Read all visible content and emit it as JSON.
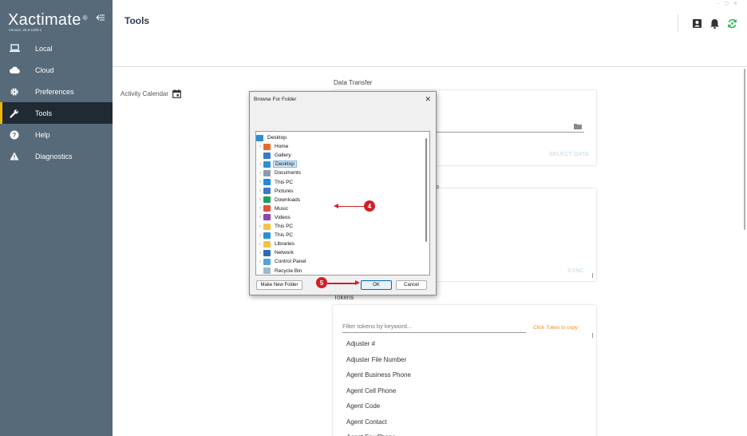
{
  "sidebar": {
    "brand": "Xactimate",
    "brand_mark": "®",
    "version": "Version: 25.8.1000.1",
    "items": [
      {
        "label": "Local",
        "icon": "laptop-icon"
      },
      {
        "label": "Cloud",
        "icon": "cloud-icon"
      },
      {
        "label": "Preferences",
        "icon": "gear-icon"
      },
      {
        "label": "Tools",
        "icon": "wrench-icon"
      },
      {
        "label": "Help",
        "icon": "help-icon"
      },
      {
        "label": "Diagnostics",
        "icon": "warning-icon"
      }
    ],
    "active": "Tools",
    "accent": "#f2b705"
  },
  "header": {
    "title": "Tools"
  },
  "content": {
    "activity_calendar": "Activity Calendar",
    "data_transfer_label": "Data Transfer",
    "select_data": "SELECT DATA",
    "sync": "SYNC",
    "partial_label": "p",
    "tokens_label": "Tokens",
    "filter_placeholder": "Filter tokens by keyword...",
    "token_hint": "Click Token to copy",
    "tokens": [
      "Adjuster #",
      "Adjuster File Number",
      "Agent Business Phone",
      "Agent Cell Phone",
      "Agent Code",
      "Agent Contact",
      "Agent Fax Phone"
    ]
  },
  "dialog": {
    "title": "Browse For Folder",
    "close": "✕",
    "tree": [
      {
        "label": "Desktop",
        "icon": "desktop-folder-icon",
        "color": "#2b8fd6",
        "indent": 0,
        "chev": false
      },
      {
        "label": "Home",
        "icon": "home-icon",
        "color": "#e86a2c",
        "indent": 1,
        "chev": true
      },
      {
        "label": "Gallery",
        "icon": "gallery-icon",
        "color": "#3a78c9",
        "indent": 1,
        "chev": false
      },
      {
        "label": "Desktop",
        "icon": "desktop-folder-icon",
        "color": "#2b8fd6",
        "indent": 1,
        "chev": true,
        "selected": true
      },
      {
        "label": "Documents",
        "icon": "documents-icon",
        "color": "#8a9bb0",
        "indent": 1,
        "chev": true
      },
      {
        "label": "This PC",
        "icon": "cloud-icon",
        "color": "#1e88e5",
        "indent": 1,
        "chev": true
      },
      {
        "label": "Pictures",
        "icon": "pictures-icon",
        "color": "#3a78c9",
        "indent": 1,
        "chev": true
      },
      {
        "label": "Downloads",
        "icon": "download-icon",
        "color": "#1aa260",
        "indent": 1,
        "chev": true
      },
      {
        "label": "Music",
        "icon": "music-icon",
        "color": "#e0523a",
        "indent": 1,
        "chev": true
      },
      {
        "label": "Videos",
        "icon": "videos-icon",
        "color": "#8e44ad",
        "indent": 1,
        "chev": true
      },
      {
        "label": "This PC",
        "icon": "folder-icon",
        "color": "#f5c242",
        "indent": 1,
        "chev": true
      },
      {
        "label": "This PC",
        "icon": "computer-icon",
        "color": "#2b8fd6",
        "indent": 1,
        "chev": true
      },
      {
        "label": "Libraries",
        "icon": "folder-icon",
        "color": "#f5c242",
        "indent": 1,
        "chev": true
      },
      {
        "label": "Network",
        "icon": "network-icon",
        "color": "#2b6cb0",
        "indent": 1,
        "chev": true
      },
      {
        "label": "Control Panel",
        "icon": "control-panel-icon",
        "color": "#4fa3e0",
        "indent": 1,
        "chev": true
      },
      {
        "label": "Recycle Bin",
        "icon": "recycle-bin-icon",
        "color": "#9fb7c9",
        "indent": 1,
        "chev": false
      }
    ],
    "make_new_folder": "Make New Folder",
    "ok": "OK",
    "cancel": "Cancel"
  },
  "annotations": {
    "step4": "4",
    "step5": "5",
    "color": "#d0202a"
  }
}
